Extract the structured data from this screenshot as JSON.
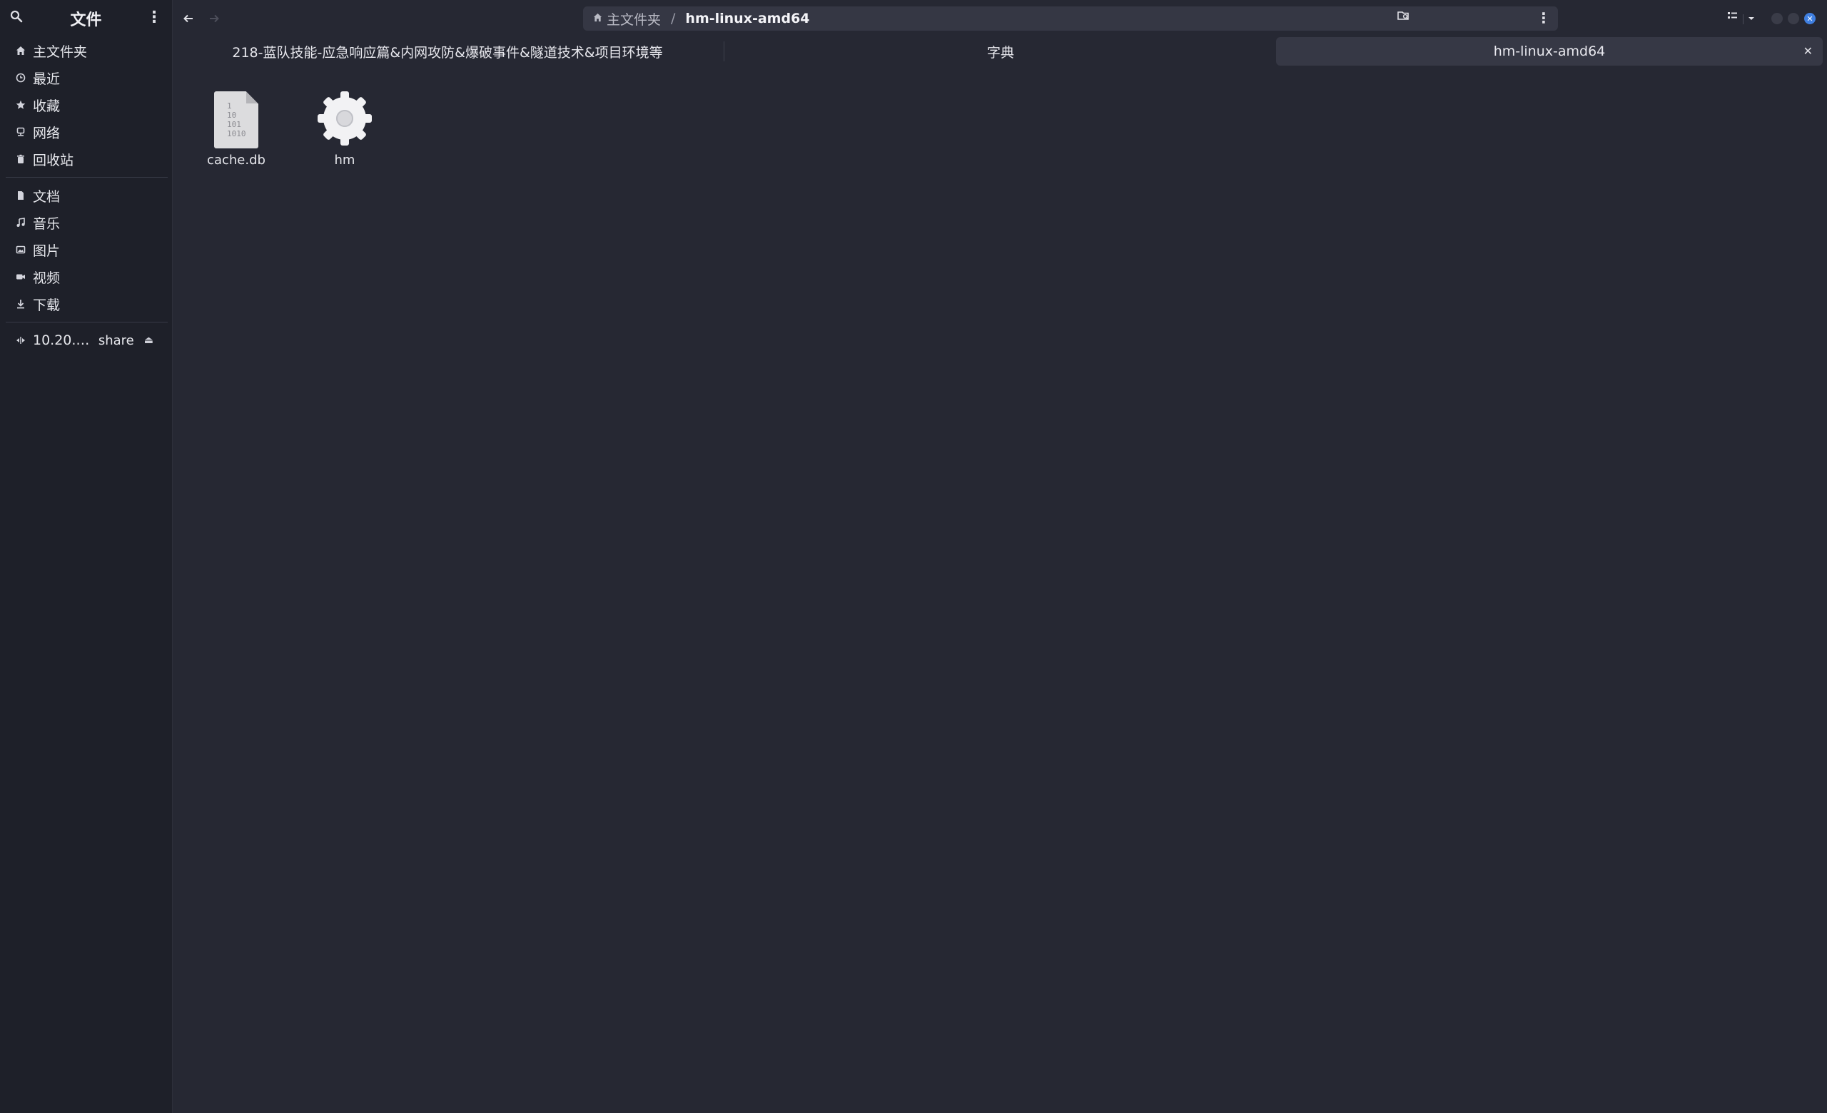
{
  "sidebar": {
    "title": "文件",
    "places": [
      {
        "label": "主文件夹",
        "icon": "home-icon"
      },
      {
        "label": "最近",
        "icon": "clock-icon"
      },
      {
        "label": "收藏",
        "icon": "star-icon"
      },
      {
        "label": "网络",
        "icon": "network-icon"
      },
      {
        "label": "回收站",
        "icon": "trash-icon"
      }
    ],
    "folders": [
      {
        "label": "文档",
        "icon": "document-icon"
      },
      {
        "label": "音乐",
        "icon": "music-icon"
      },
      {
        "label": "图片",
        "icon": "picture-icon"
      },
      {
        "label": "视频",
        "icon": "video-icon"
      },
      {
        "label": "下载",
        "icon": "download-icon"
      }
    ],
    "network_mount": {
      "label": "10.20.…",
      "share": "share",
      "icon": "network-share-icon"
    }
  },
  "pathbar": {
    "home": "主文件夹",
    "separator": "/",
    "current": "hm-linux-amd64"
  },
  "tabs": [
    {
      "label": "218-蓝队技能-应急响应篇&内网攻防&爆破事件&隧道技术&项目环境等",
      "active": false
    },
    {
      "label": "字典",
      "active": false
    },
    {
      "label": "hm-linux-amd64",
      "active": true
    }
  ],
  "files": [
    {
      "name": "cache.db",
      "type": "binary-file-icon",
      "binary_lines": [
        "1",
        "10",
        "101",
        "1010"
      ]
    },
    {
      "name": "hm",
      "type": "executable-gear-icon"
    }
  ],
  "colors": {
    "background": "#262833",
    "sidebar": "#1e2029",
    "accent": "#3f7fe0"
  }
}
